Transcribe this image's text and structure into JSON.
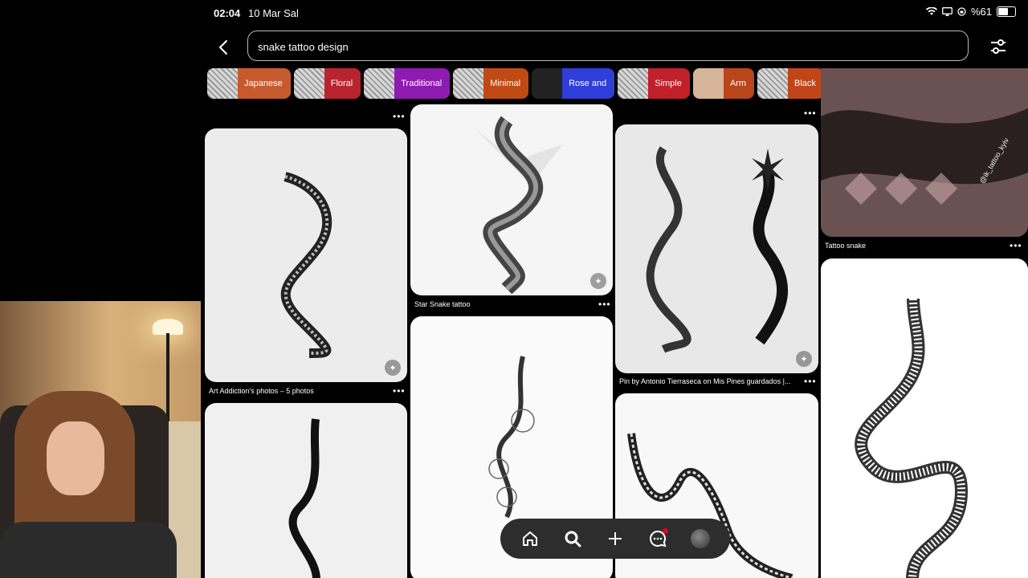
{
  "status": {
    "time": "02:04",
    "date": "10 Mar Sal",
    "battery": "%61"
  },
  "search": {
    "query": "snake tattoo design"
  },
  "chips": [
    {
      "label": "Japanese",
      "color": "#c65a2e"
    },
    {
      "label": "Floral",
      "color": "#b8242e"
    },
    {
      "label": "Traditional",
      "color": "#8e1bb0"
    },
    {
      "label": "Minimal",
      "color": "#c04a14"
    },
    {
      "label": "Rose and",
      "color": "#2f3ed8"
    },
    {
      "label": "Simple",
      "color": "#c0202a"
    },
    {
      "label": "Arm",
      "color": "#b8461a"
    },
    {
      "label": "Black",
      "color": "#c0461a"
    }
  ],
  "pins": {
    "art_addiction": "Art Addiction's photos – 5 photos",
    "star_snake": "Star Snake tattoo",
    "antonio": "Pin by Antonio Tierraseca on Mis Pines guardados |...",
    "tattoo_snake": "Tattoo snake",
    "watermark": "@ik_tattoo_kyiv"
  },
  "more_label": "•••",
  "nav": [
    "home-icon",
    "search-icon",
    "plus-icon",
    "chat-icon",
    "profile-avatar"
  ]
}
